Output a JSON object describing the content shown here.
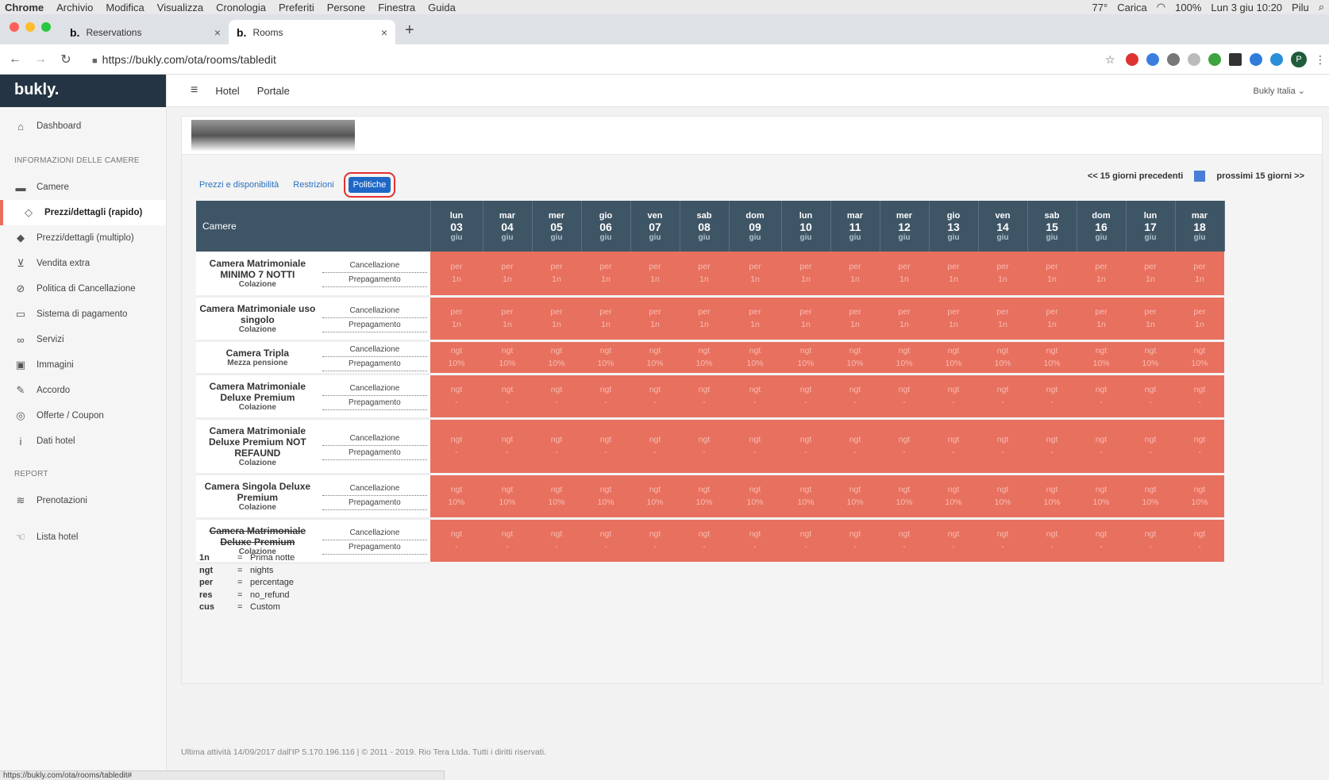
{
  "macbar": {
    "app": "Chrome",
    "menus": [
      "Archivio",
      "Modifica",
      "Visualizza",
      "Cronologia",
      "Preferiti",
      "Persone",
      "Finestra",
      "Guida"
    ],
    "temp": "77°",
    "battery": "100%",
    "charge": "Carica",
    "datetime": "Lun 3 giu 10:20",
    "user": "Pilu"
  },
  "tabs": [
    {
      "label": "Reservations"
    },
    {
      "label": "Rooms"
    }
  ],
  "address": {
    "url": "https://bukly.com/ota/rooms/tabledit"
  },
  "sidebar": {
    "logo": "bukly.",
    "dashboard": "Dashboard",
    "section1": "INFORMAZIONI DELLE CAMERE",
    "items": [
      "Camere",
      "Prezzi/dettagli (rapido)",
      "Prezzi/dettagli (multiplo)",
      "Vendita extra",
      "Politica di Cancellazione",
      "Sistema di pagamento",
      "Servizi",
      "Immagini",
      "Accordo",
      "Offerte / Coupon",
      "Dati hotel"
    ],
    "section2": "REPORT",
    "report_items": [
      "Prenotazioni"
    ],
    "lista": "Lista hotel"
  },
  "topnav": {
    "hotel": "Hotel",
    "portale": "Portale",
    "account": "Bukly Italia ⌄"
  },
  "subtabs": {
    "t1": "Prezzi e disponibilità",
    "t2": "Restrizioni",
    "t3": "Politiche"
  },
  "pager": {
    "prev": "<< 15 giorni precedenti",
    "next": "prossimi 15 giorni >>"
  },
  "grid": {
    "header_label": "Camere",
    "days": [
      {
        "n": "lun",
        "d": "03",
        "m": "giu"
      },
      {
        "n": "mar",
        "d": "04",
        "m": "giu"
      },
      {
        "n": "mer",
        "d": "05",
        "m": "giu"
      },
      {
        "n": "gio",
        "d": "06",
        "m": "giu"
      },
      {
        "n": "ven",
        "d": "07",
        "m": "giu"
      },
      {
        "n": "sab",
        "d": "08",
        "m": "giu"
      },
      {
        "n": "dom",
        "d": "09",
        "m": "giu"
      },
      {
        "n": "lun",
        "d": "10",
        "m": "giu"
      },
      {
        "n": "mar",
        "d": "11",
        "m": "giu"
      },
      {
        "n": "mer",
        "d": "12",
        "m": "giu"
      },
      {
        "n": "gio",
        "d": "13",
        "m": "giu"
      },
      {
        "n": "ven",
        "d": "14",
        "m": "giu"
      },
      {
        "n": "sab",
        "d": "15",
        "m": "giu"
      },
      {
        "n": "dom",
        "d": "16",
        "m": "giu"
      },
      {
        "n": "lun",
        "d": "17",
        "m": "giu"
      },
      {
        "n": "mar",
        "d": "18",
        "m": "giu"
      }
    ],
    "row_labels": [
      "Cancellazione",
      "Prepagamento"
    ],
    "rows": [
      {
        "name": "Camera Matrimoniale MINIMO 7 NOTTI",
        "sub": "Colazione",
        "c": "per",
        "p": "1n",
        "strike": false,
        "h": 56
      },
      {
        "name": "Camera Matrimoniale uso singolo",
        "sub": "Colazione",
        "c": "per",
        "p": "1n",
        "strike": false,
        "h": 56
      },
      {
        "name": "Camera Tripla",
        "sub": "Mezza pensione",
        "c": "ngt",
        "p": "10%",
        "strike": false,
        "h": 42
      },
      {
        "name": "Camera Matrimoniale Deluxe Premium",
        "sub": "Colazione",
        "c": "ngt",
        "p": "-",
        "strike": false,
        "h": 56
      },
      {
        "name": "Camera Matrimoniale Deluxe Premium NOT REFAUND",
        "sub": "Colazione",
        "c": "ngt",
        "p": "-",
        "strike": false,
        "h": 70
      },
      {
        "name": "Camera Singola Deluxe Premium",
        "sub": "Colazione",
        "c": "ngt",
        "p": "10%",
        "strike": false,
        "h": 56
      },
      {
        "name": "Camera Matrimoniale Deluxe Premium",
        "sub": "Colazione",
        "c": "ngt",
        "p": "-",
        "strike": true,
        "h": 56
      }
    ]
  },
  "legend": [
    {
      "k": "1n",
      "v": "Prima notte"
    },
    {
      "k": "ngt",
      "v": "nights"
    },
    {
      "k": "per",
      "v": "percentage"
    },
    {
      "k": "res",
      "v": "no_refund"
    },
    {
      "k": "cus",
      "v": "Custom"
    }
  ],
  "footer": "Ultima attività 14/09/2017 dall'IP 5.170.196.116 | © 2011 - 2019. Rio Tera Ltda. Tutti i diritti riservati.",
  "status": "https://bukly.com/ota/rooms/tabledit#"
}
